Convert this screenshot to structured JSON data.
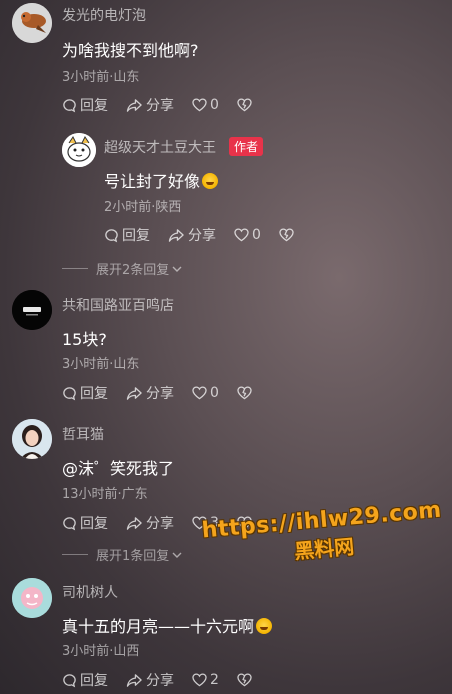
{
  "comments": [
    {
      "name": "发光的电灯泡",
      "text": "为啥我搜不到他啊?",
      "meta": "3小时前·山东",
      "reply": "回复",
      "share": "分享",
      "likes": "0"
    },
    {
      "name": "超级天才土豆大王",
      "tag": "作者",
      "text": "号让封了好像",
      "meta": "2小时前·陕西",
      "reply": "回复",
      "share": "分享",
      "likes": "0",
      "emoji": "laugh-cry-emoji"
    },
    {
      "name": "共和国路亚百鸣店",
      "text": "15块?",
      "meta": "3小时前·山东",
      "reply": "回复",
      "share": "分享",
      "likes": "0"
    },
    {
      "name": "哲耳猫",
      "text": "@沫゜笑死我了",
      "meta": "13小时前·广东",
      "reply": "回复",
      "share": "分享",
      "likes": "3"
    },
    {
      "name": "司机树人",
      "text": "真十五的月亮——十六元啊",
      "meta": "3小时前·山西",
      "reply": "回复",
      "share": "分享",
      "likes": "2",
      "emoji": "laugh-cry-emoji"
    }
  ],
  "expand": [
    {
      "label": "展开2条回复"
    },
    {
      "label": "展开1条回复"
    }
  ],
  "watermark": {
    "url": "https://ihlw29.com",
    "cn": "黑料网"
  },
  "colors": {
    "author_tag": "#e8334a",
    "watermark": "#f4a41c"
  }
}
